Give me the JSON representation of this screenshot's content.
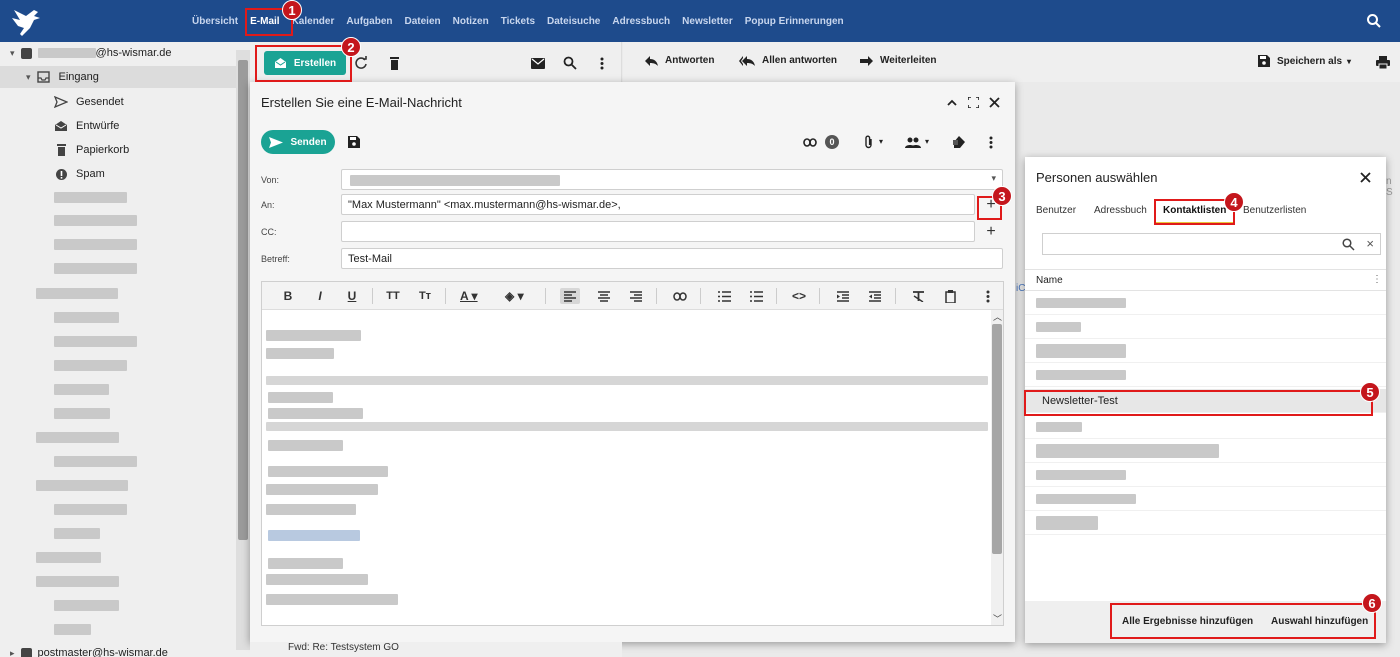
{
  "nav": {
    "items": [
      "Übersicht",
      "E-Mail",
      "Kalender",
      "Aufgaben",
      "Dateien",
      "Notizen",
      "Tickets",
      "Dateisuche",
      "Adressbuch",
      "Newsletter",
      "Popup Erinnerungen"
    ],
    "active": "E-Mail"
  },
  "sidebar": {
    "account_suffix": "@hs-wismar.de",
    "inbox": "Eingang",
    "folders": [
      "Gesendet",
      "Entwürfe",
      "Papierkorb",
      "Spam"
    ],
    "second_account": "postmaster@hs-wismar.de"
  },
  "mid_toolbar": {
    "create_label": "Erstellen"
  },
  "right_toolbar": {
    "reply": "Antworten",
    "reply_all": "Allen antworten",
    "forward": "Weiterleiten",
    "save_as": "Speichern als"
  },
  "compose": {
    "title": "Erstellen Sie eine E-Mail-Nachricht",
    "send_label": "Senden",
    "link_count": "0",
    "from_label": "Von:",
    "to_label": "An:",
    "to_value": "\"Max Mustermann\" <max.mustermann@hs-wismar.de>,",
    "cc_label": "CC:",
    "subject_label": "Betreff:",
    "subject_value": "Test-Mail"
  },
  "below_compose": {
    "item": "Fwd: Re: Testsystem GO"
  },
  "dialog": {
    "title": "Personen auswählen",
    "tabs": [
      "Benutzer",
      "Adressbuch",
      "Kontaktlisten",
      "Benutzerlisten"
    ],
    "active_tab": "Kontaktlisten",
    "column_name": "Name",
    "highlight_row": "Newsletter-Test",
    "add_all_label": "Alle Ergebnisse hinzufügen",
    "add_selection_label": "Auswahl hinzufügen"
  },
  "annotations": [
    "1",
    "2",
    "3",
    "4",
    "5",
    "6"
  ],
  "colors": {
    "nav_bg": "#1e4b8c",
    "accent_teal": "#1aa394",
    "marker_red": "#e01a1a"
  }
}
